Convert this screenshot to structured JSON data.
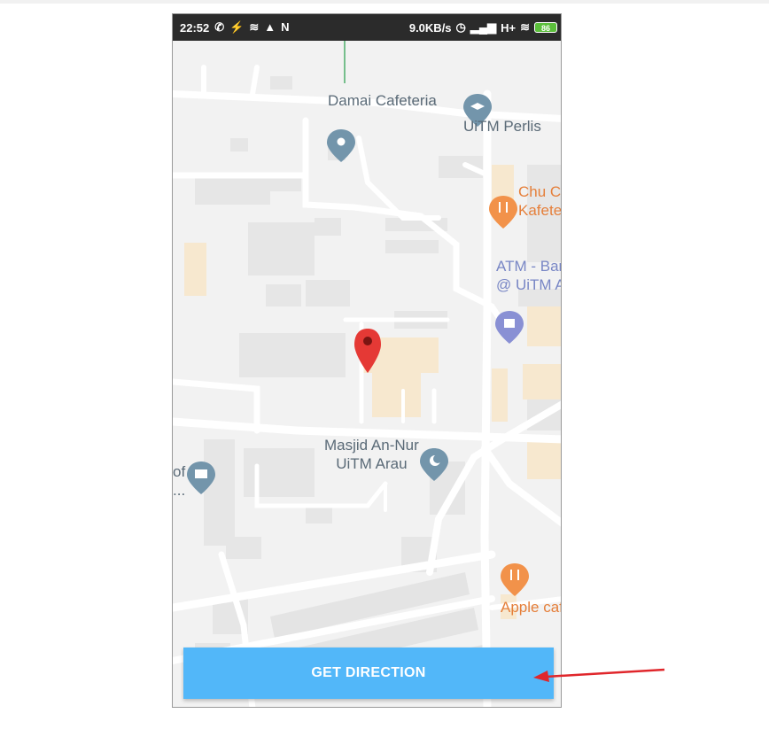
{
  "status_bar": {
    "time": "22:52",
    "network_speed": "9.0KB/s",
    "signal": "H+",
    "battery": "86",
    "left_icons": [
      "whatsapp-icon",
      "bolt-icon",
      "wifi-question-icon",
      "warning-icon",
      "n-icon"
    ],
    "right_icons": [
      "alarm-icon",
      "signal-icon",
      "wifi-icon",
      "battery-icon"
    ]
  },
  "map": {
    "places": [
      {
        "name": "Damai Cafeteria",
        "type": "gray",
        "icon": "place-pin-icon"
      },
      {
        "name": "UiTM Perlis",
        "type": "gray",
        "icon": "school-pin-icon"
      },
      {
        "name": "Chu Ca\nKafete",
        "type": "orange",
        "icon": "restaurant-pin-icon"
      },
      {
        "name": "ATM - Ban\n@ UiTM A",
        "type": "purple",
        "icon": "atm-pin-icon"
      },
      {
        "name": "Masjid An-Nur\nUiTM Arau",
        "type": "gray",
        "icon": "mosque-pin-icon"
      },
      {
        "name": "of\n...",
        "type": "gray",
        "icon": "museum-pin-icon"
      },
      {
        "name": "Apple caf",
        "type": "orange",
        "icon": "restaurant-pin-icon"
      }
    ],
    "marker_color": "#e53935"
  },
  "action_button": {
    "label": "GET DIRECTION",
    "color": "#52b7f9"
  },
  "annotation": {
    "arrow_color": "#e0262b"
  }
}
